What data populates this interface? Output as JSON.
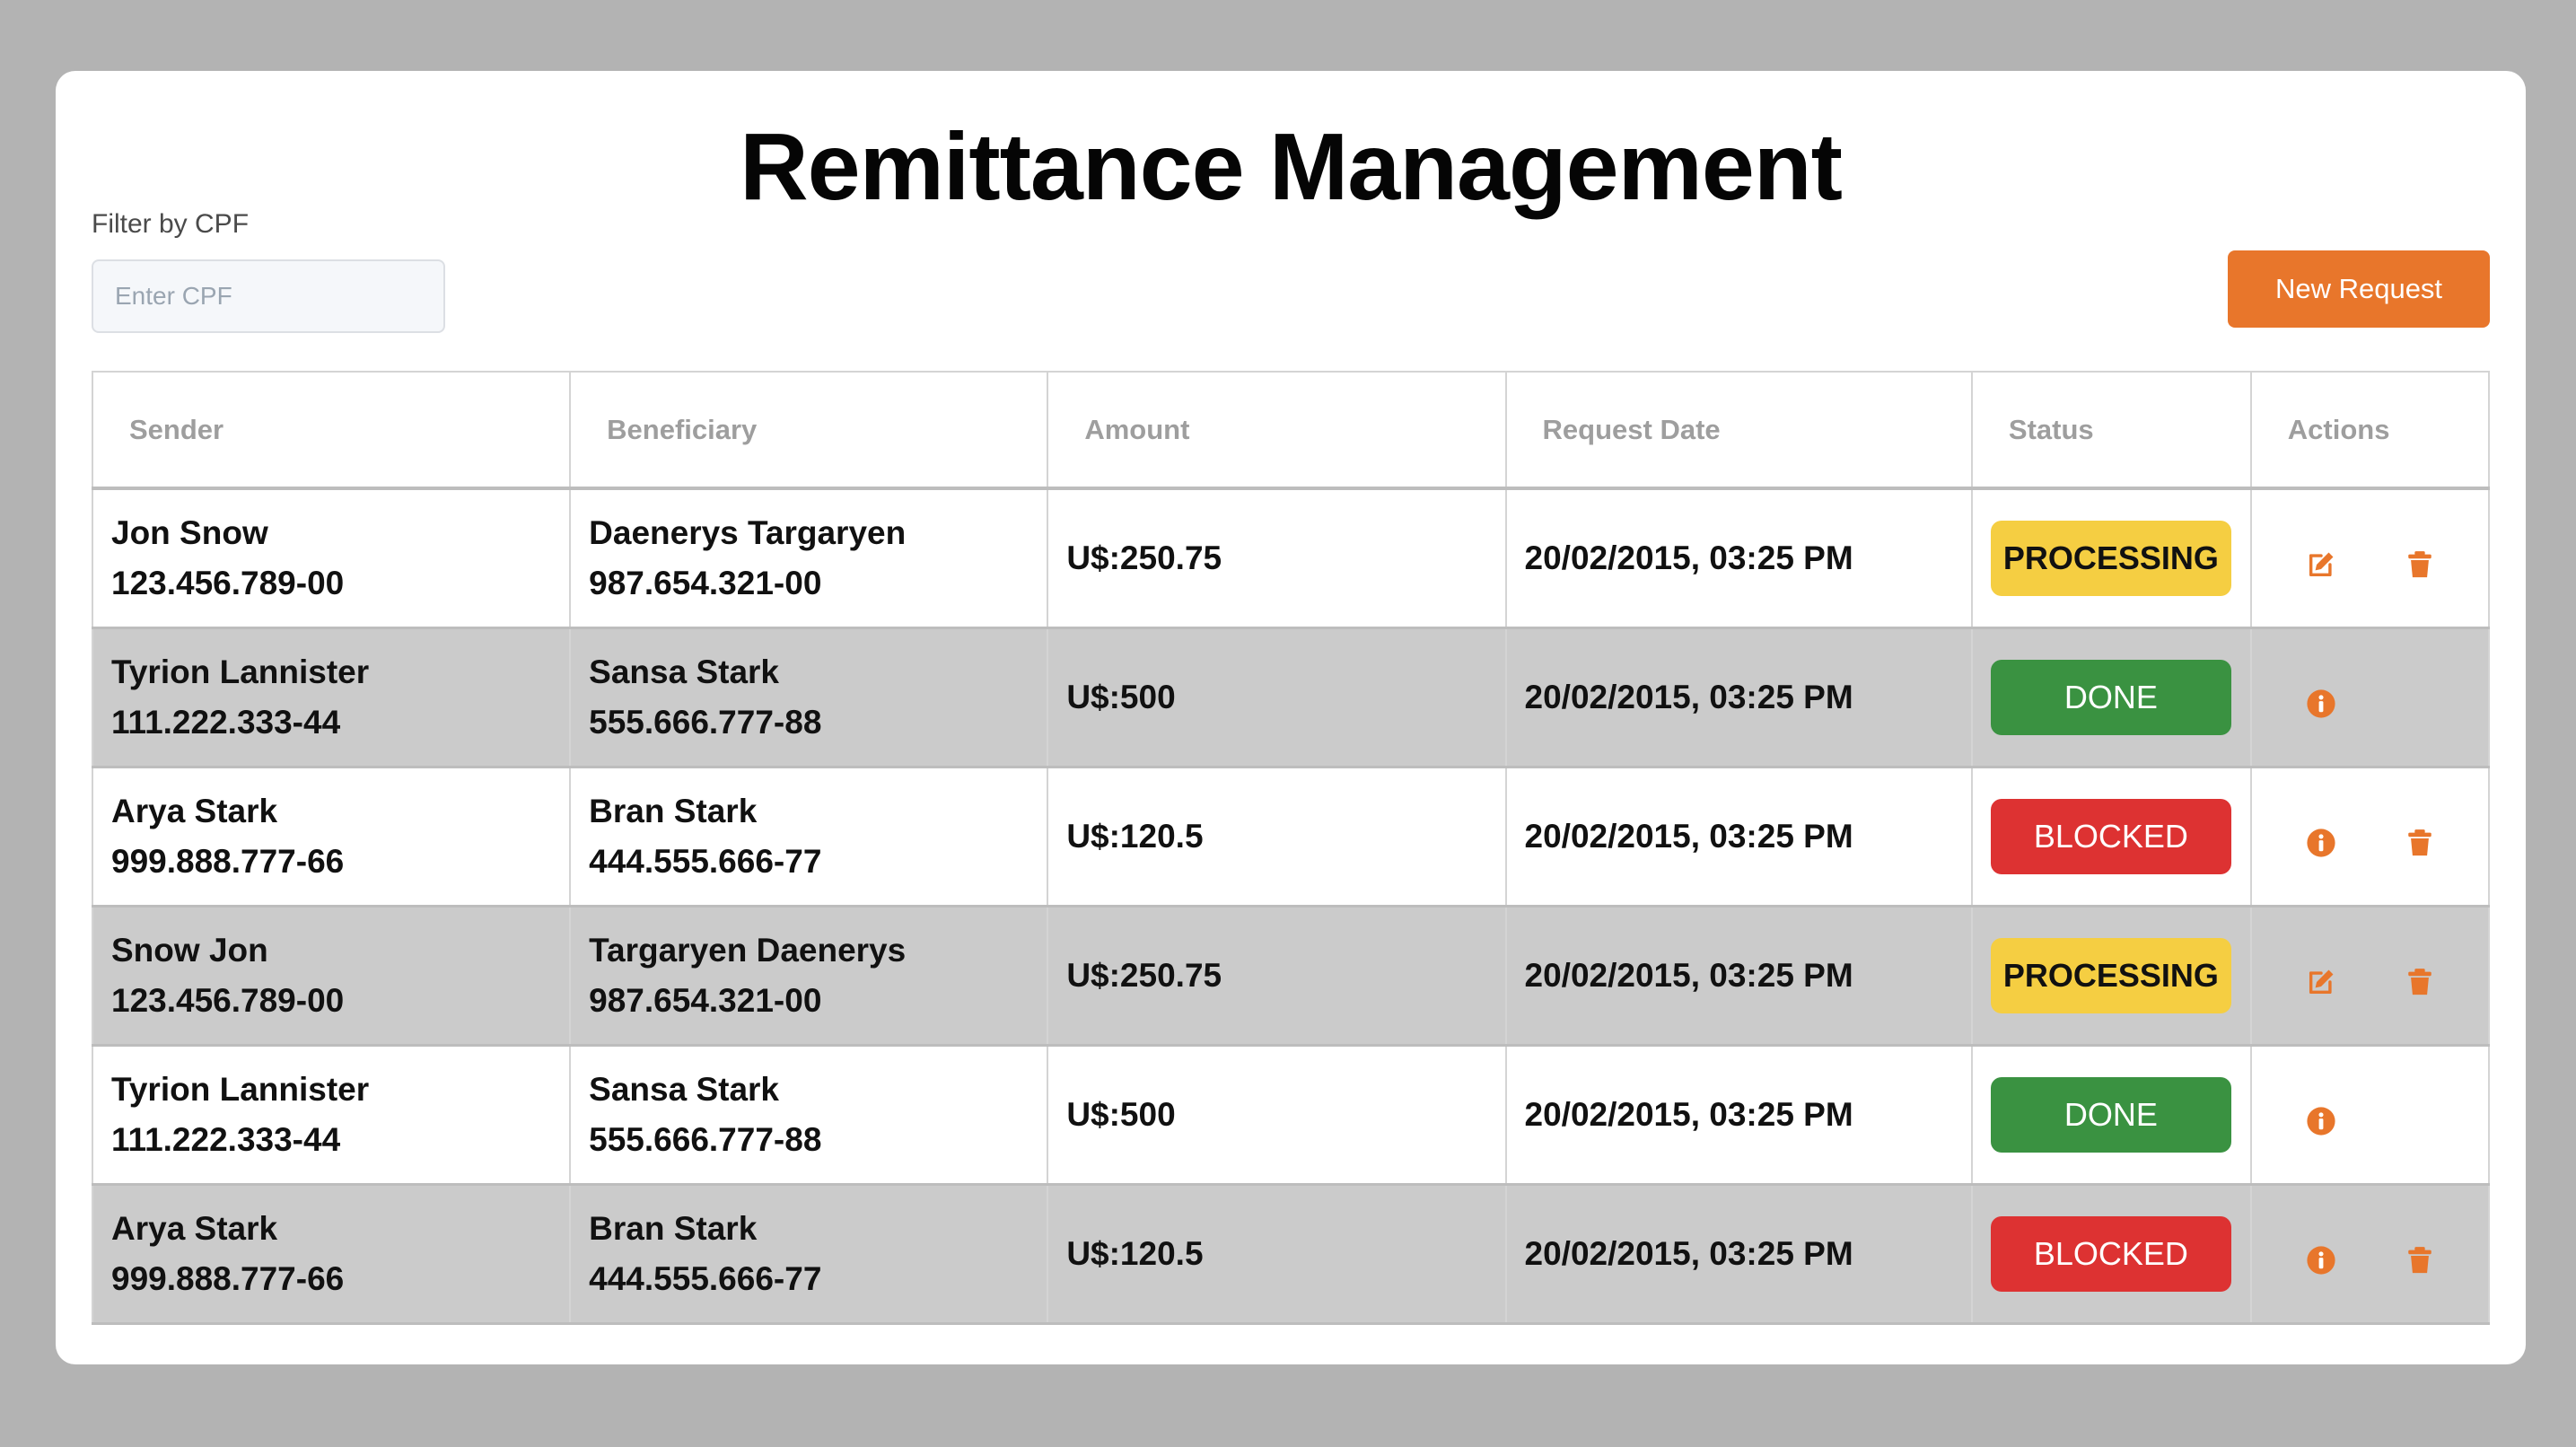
{
  "page": {
    "title": "Remittance Management"
  },
  "filter": {
    "label": "Filter by CPF",
    "placeholder": "Enter CPF",
    "value": ""
  },
  "toolbar": {
    "new_request_label": "New Request"
  },
  "colors": {
    "accent": "#e8762b",
    "processing": "#f5ce42",
    "done": "#3a9241",
    "blocked": "#dd3232",
    "row_alt": "#cbcbcb",
    "background": "#b3b3b3"
  },
  "table": {
    "headers": {
      "sender": "Sender",
      "beneficiary": "Beneficiary",
      "amount": "Amount",
      "date": "Request Date",
      "status": "Status",
      "actions": "Actions"
    },
    "rows": [
      {
        "sender_name": "Jon Snow",
        "sender_cpf": "123.456.789-00",
        "beneficiary_name": "Daenerys Targaryen",
        "beneficiary_cpf": "987.654.321-00",
        "amount": "U$:250.75",
        "date": "20/02/2015, 03:25 PM",
        "status": "PROCESSING",
        "actions": [
          "edit-icon",
          "trash-icon"
        ]
      },
      {
        "sender_name": "Tyrion Lannister",
        "sender_cpf": "111.222.333-44",
        "beneficiary_name": "Sansa Stark",
        "beneficiary_cpf": "555.666.777-88",
        "amount": "U$:500",
        "date": "20/02/2015, 03:25 PM",
        "status": "DONE",
        "actions": [
          "info-icon"
        ]
      },
      {
        "sender_name": "Arya Stark",
        "sender_cpf": "999.888.777-66",
        "beneficiary_name": "Bran Stark",
        "beneficiary_cpf": "444.555.666-77",
        "amount": "U$:120.5",
        "date": "20/02/2015, 03:25 PM",
        "status": "BLOCKED",
        "actions": [
          "info-icon",
          "trash-icon"
        ]
      },
      {
        "sender_name": "Snow Jon",
        "sender_cpf": "123.456.789-00",
        "beneficiary_name": "Targaryen Daenerys",
        "beneficiary_cpf": "987.654.321-00",
        "amount": "U$:250.75",
        "date": "20/02/2015, 03:25 PM",
        "status": "PROCESSING",
        "actions": [
          "edit-icon",
          "trash-icon"
        ]
      },
      {
        "sender_name": "Tyrion Lannister",
        "sender_cpf": "111.222.333-44",
        "beneficiary_name": "Sansa Stark",
        "beneficiary_cpf": "555.666.777-88",
        "amount": "U$:500",
        "date": "20/02/2015, 03:25 PM",
        "status": "DONE",
        "actions": [
          "info-icon"
        ]
      },
      {
        "sender_name": "Arya Stark",
        "sender_cpf": "999.888.777-66",
        "beneficiary_name": "Bran Stark",
        "beneficiary_cpf": "444.555.666-77",
        "amount": "U$:120.5",
        "date": "20/02/2015, 03:25 PM",
        "status": "BLOCKED",
        "actions": [
          "info-icon",
          "trash-icon"
        ]
      }
    ]
  }
}
